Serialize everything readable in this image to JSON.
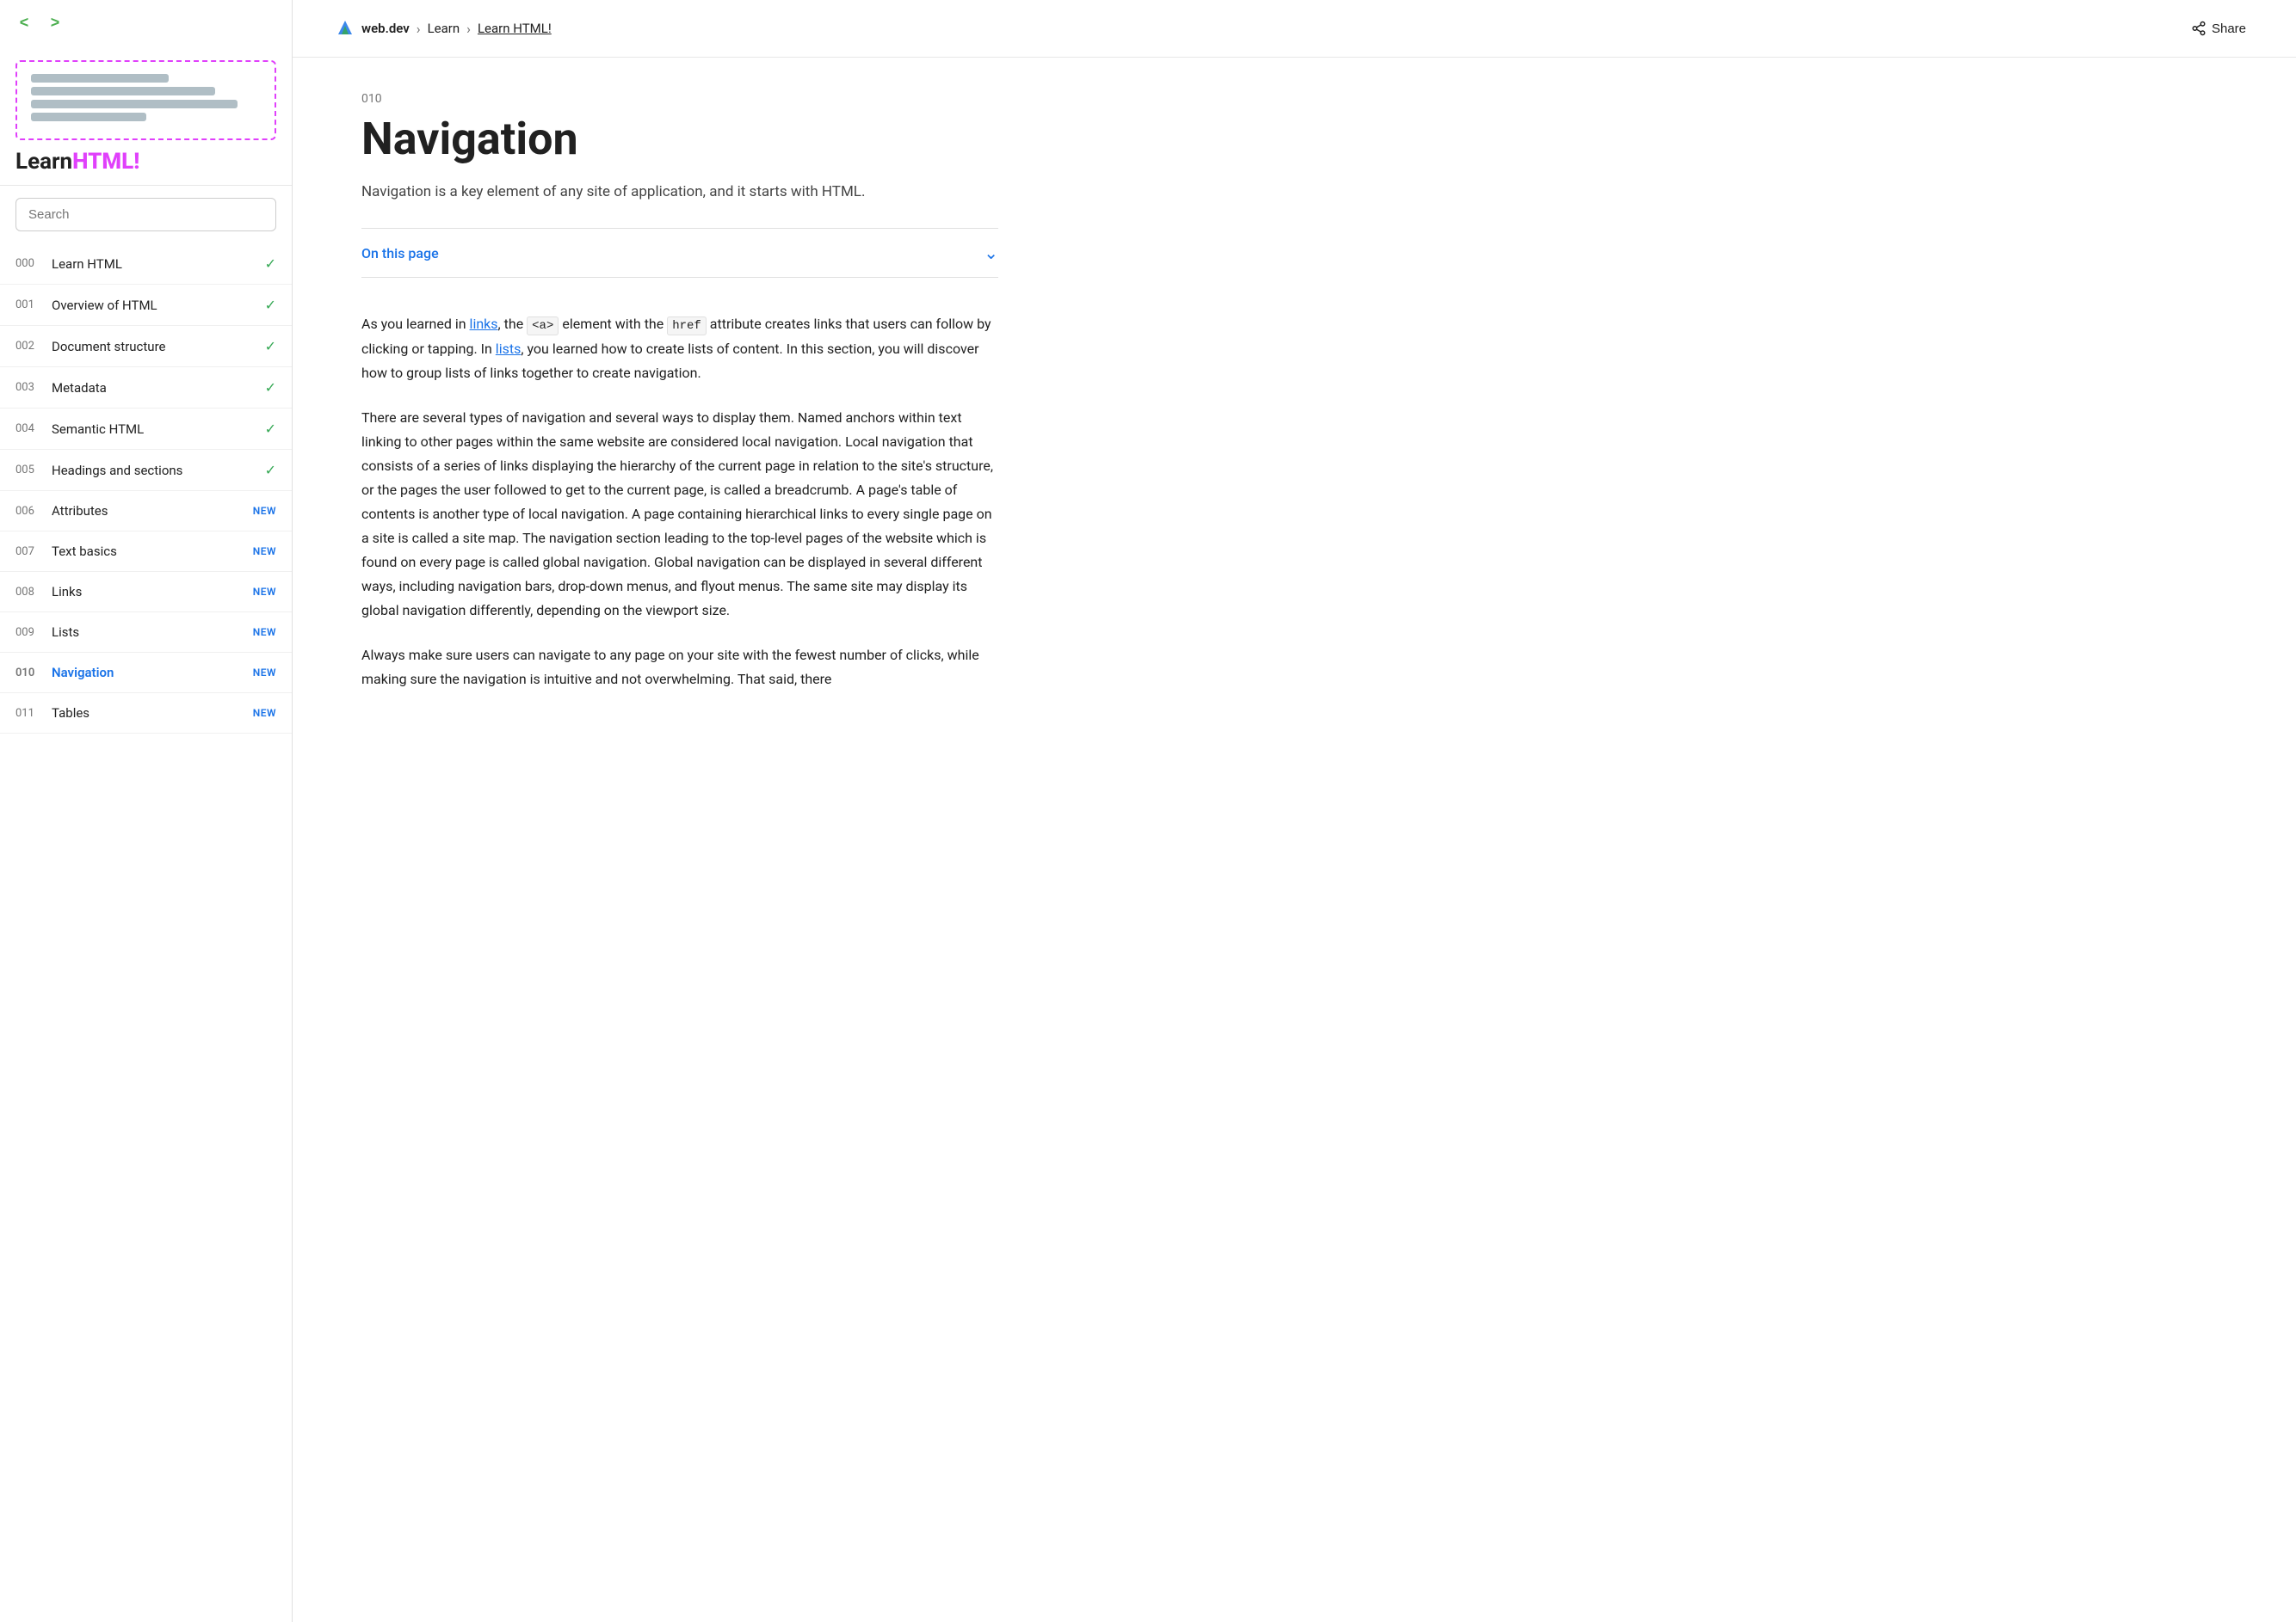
{
  "sidebar": {
    "logo": {
      "learn": "Learn",
      "html": "HTML!"
    },
    "search_placeholder": "Search",
    "nav_items": [
      {
        "num": "000",
        "label": "Learn HTML",
        "badge": "check",
        "active": false
      },
      {
        "num": "001",
        "label": "Overview of HTML",
        "badge": "check",
        "active": false
      },
      {
        "num": "002",
        "label": "Document structure",
        "badge": "check",
        "active": false
      },
      {
        "num": "003",
        "label": "Metadata",
        "badge": "check",
        "active": false
      },
      {
        "num": "004",
        "label": "Semantic HTML",
        "badge": "check",
        "active": false
      },
      {
        "num": "005",
        "label": "Headings and sections",
        "badge": "check",
        "active": false
      },
      {
        "num": "006",
        "label": "Attributes",
        "badge": "new",
        "active": false
      },
      {
        "num": "007",
        "label": "Text basics",
        "badge": "new",
        "active": false
      },
      {
        "num": "008",
        "label": "Links",
        "badge": "new",
        "active": false
      },
      {
        "num": "009",
        "label": "Lists",
        "badge": "new",
        "active": false
      },
      {
        "num": "010",
        "label": "Navigation",
        "badge": "new",
        "active": true
      },
      {
        "num": "011",
        "label": "Tables",
        "badge": "new",
        "active": false
      }
    ]
  },
  "topbar": {
    "site_name": "web.dev",
    "breadcrumb_learn": "Learn",
    "breadcrumb_current": "Learn HTML!",
    "share_label": "Share"
  },
  "article": {
    "num": "010",
    "title": "Navigation",
    "intro": "Navigation is a key element of any site of application, and it starts with HTML.",
    "on_this_page": "On this page",
    "body_p1_start": "As you learned in ",
    "body_p1_link1": "links",
    "body_p1_mid1": ", the ",
    "body_p1_code1": "<a>",
    "body_p1_mid2": " element with the ",
    "body_p1_code2": "href",
    "body_p1_mid3": " attribute creates links that users can follow by clicking or tapping. In ",
    "body_p1_link2": "lists",
    "body_p1_end": ", you learned how to create lists of content. In this section, you will discover how to group lists of links together to create navigation.",
    "body_p2": "There are several types of navigation and several ways to display them. Named anchors within text linking to other pages within the same website are considered local navigation. Local navigation that consists of a series of links displaying the hierarchy of the current page in relation to the site's structure, or the pages the user followed to get to the current page, is called a breadcrumb. A page's table of contents is another type of local navigation. A page containing hierarchical links to every single page on a site is called a site map. The navigation section leading to the top-level pages of the website which is found on every page is called global navigation. Global navigation can be displayed in several different ways, including navigation bars, drop-down menus, and flyout menus. The same site may display its global navigation differently, depending on the viewport size.",
    "body_p3_start": "Always make sure users can navigate to any page on your site with the fewest number of clicks, while making sure the navigation is intuitive and not overwhelming. That said, there"
  }
}
